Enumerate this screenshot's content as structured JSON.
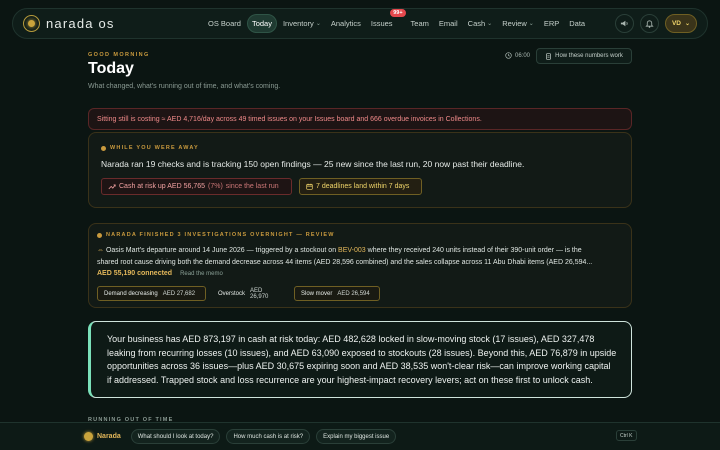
{
  "app": {
    "name": "narada os"
  },
  "nav": {
    "items": [
      {
        "label": "OS Board",
        "active": false
      },
      {
        "label": "Today",
        "active": true
      },
      {
        "label": "Inventory",
        "dropdown": true
      },
      {
        "label": "Analytics"
      },
      {
        "label": "Issues",
        "badge": "99+"
      },
      {
        "label": "Team"
      },
      {
        "label": "Email"
      },
      {
        "label": "Cash",
        "dropdown": true
      },
      {
        "label": "Review",
        "dropdown": true
      },
      {
        "label": "ERP"
      },
      {
        "label": "Data"
      }
    ]
  },
  "user": {
    "initials": "VD"
  },
  "header": {
    "greeting": "GOOD MORNING",
    "title": "Today",
    "subtitle": "What changed, what's running out of time, and what's coming.",
    "time": "06:00",
    "how_button": "How these numbers work"
  },
  "alert": {
    "text": "Sitting still is costing ≈ AED 4,716/day across 49 timed issues on your Issues board and 666 overdue invoices in Collections."
  },
  "away": {
    "eyebrow": "WHILE YOU WERE AWAY",
    "text": "Narada ran 19 checks and is tracking 150 open findings — 25 new since the last run, 20 now past their deadline.",
    "cash_chip": {
      "label": "Cash at risk up AED 56,765",
      "pct": "(7%)",
      "suffix": "since the last run"
    },
    "deadline_chip": "7 deadlines land within 7 days"
  },
  "memo": {
    "eyebrow": "NARADA FINISHED 3 INVESTIGATIONS OVERNIGHT — REVIEW",
    "line1_pre": "Oasis Mart's departure around 14 June 2026 — triggered by a stockout on ",
    "line1_hl": "BEV-003",
    "line1_post": " where they received 240 units instead of their 390-unit order — is the",
    "line2": "shared root cause driving both the demand decrease across 44 items (AED 28,596 combined) and the sales collapse across 11 Abu Dhabi items (AED 26,594...",
    "connected": "AED 55,190 connected",
    "read_link": "Read the memo",
    "tags": [
      {
        "label": "Demand decreasing",
        "amount": "AED 27,682"
      },
      {
        "label": "Overstock",
        "amount": "AED 26,970"
      },
      {
        "label": "Slow mover",
        "amount": "AED 26,594"
      }
    ]
  },
  "summary": {
    "text": "Your business has AED 873,197 in cash at risk today: AED 482,628 locked in slow-moving stock (17 issues), AED 327,478 leaking from recurring losses (10 issues), and AED 63,090 exposed to stockouts (28 issues). Beyond this, AED 76,879 in upside opportunities across 36 issues—plus AED 30,675 expiring soon and AED 38,535 won't-clear risk—can improve working capital if addressed. Trapped stock and loss recurrence are your highest-impact recovery levers; act on these first to unlock cash."
  },
  "partial_section": "RUNNING OUT OF TIME",
  "assistant": {
    "name": "Narada",
    "prompts": [
      "What should I look at today?",
      "How much cash is at risk?",
      "Explain my biggest issue"
    ],
    "shortcut": "Ctrl K"
  },
  "colors": {
    "accent_gold": "#c99a3e",
    "alert_red": "#f08a8a",
    "highlight_green": "#7be0b9",
    "badge_red": "#e5484d"
  }
}
